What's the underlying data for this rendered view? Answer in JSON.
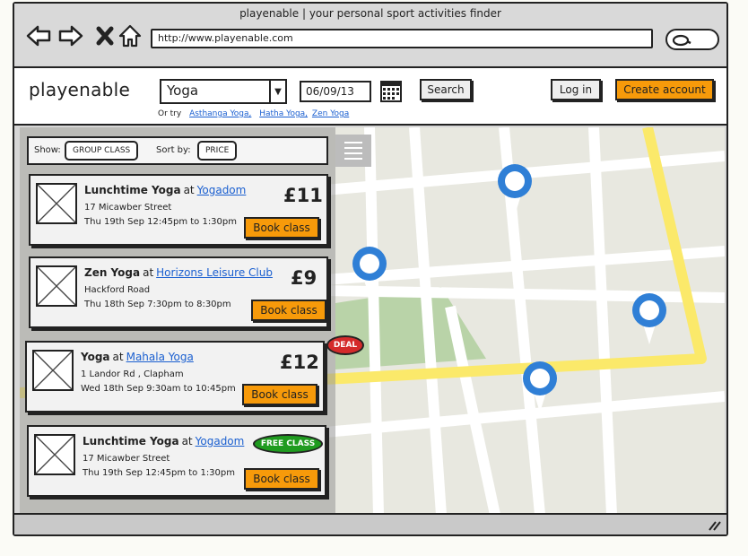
{
  "browser": {
    "title": "playenable | your personal sport activities finder",
    "url": "http://www.playenable.com"
  },
  "header": {
    "logo": "playenable",
    "activity": "Yoga",
    "date": "06/09/13",
    "search_label": "Search",
    "login_label": "Log in",
    "create_account_label": "Create account",
    "or_try_label": "Or try",
    "suggestions": [
      "Asthanga Yoga,",
      "Hatha Yoga,",
      "Zen Yoga"
    ]
  },
  "filters": {
    "show_label": "Show:",
    "show_value": "GROUP CLASS",
    "sort_label": "Sort by:",
    "sort_value": "PRICE"
  },
  "results": [
    {
      "title": "Lunchtime Yoga",
      "at": "at",
      "venue": "Yogadom",
      "address": "17 Micawber Street",
      "time": "Thu 19th Sep 12:45pm to 1:30pm",
      "price": "£11",
      "book": "Book class",
      "badge": ""
    },
    {
      "title": "Zen Yoga",
      "at": "at",
      "venue": "Horizons Leisure Club",
      "address": "Hackford Road",
      "time": "Thu 18th Sep 7:30pm to 8:30pm",
      "price": "£9",
      "book": "Book class",
      "badge": ""
    },
    {
      "title": "Yoga",
      "at": "at",
      "venue": "Mahala Yoga",
      "address": "1 Landor Rd , Clapham",
      "time": "Wed 18th Sep 9:30am to 10:45pm",
      "price": "£12",
      "book": "Book class",
      "badge": "DEAL"
    },
    {
      "title": "Lunchtime Yoga",
      "at": "at",
      "venue": "Yogadom",
      "address": "17 Micawber Street",
      "time": "Thu 19th Sep 12:45pm to 1:30pm",
      "price": "",
      "book": "Book class",
      "badge": "FREE CLASS"
    }
  ],
  "colors": {
    "accent": "#f79a0a",
    "link": "#1a5fd0",
    "pin": "#2f7fd6",
    "deal": "#d42b2b",
    "free": "#1f9b1f",
    "road": "#fbe96a",
    "park": "#b9d3a8"
  },
  "icons": [
    "back-arrow-icon",
    "forward-arrow-icon",
    "stop-icon",
    "home-icon",
    "search-icon",
    "calendar-icon",
    "dropdown-arrow-icon",
    "menu-icon",
    "map-pin-icon",
    "resize-grip-icon",
    "image-placeholder-icon"
  ]
}
